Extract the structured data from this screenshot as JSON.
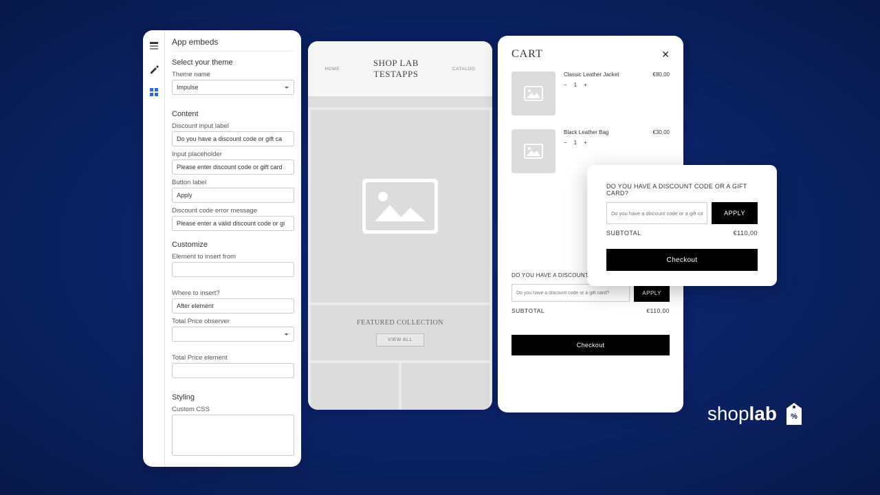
{
  "admin": {
    "title": "App embeds",
    "select_theme_heading": "Select your theme",
    "theme_name_label": "Theme name",
    "theme_value": "Impulse",
    "content_heading": "Content",
    "fields": {
      "discount_input_label": {
        "label": "Discount input label",
        "value": "Do you have a discount code or gift ca"
      },
      "input_placeholder": {
        "label": "Input placeholder",
        "value": "Please enter discount code or gift card"
      },
      "button_label": {
        "label": "Button label",
        "value": "Apply"
      },
      "discount_error": {
        "label": "Discount code error message",
        "value": "Please enter a valid discount code or gi"
      }
    },
    "customize_heading": "Customize",
    "element_to_insert_label": "Element to insert from",
    "where_to_insert_label": "Where to insert?",
    "where_to_insert_value": "After element",
    "total_price_observer_label": "Total Price observer",
    "total_price_element_label": "Total Price element",
    "styling_heading": "Styling",
    "custom_css_label": "Custom CSS"
  },
  "preview": {
    "home": "HOME",
    "catalog": "CATALOG",
    "logo_line1": "SHOP LAB",
    "logo_line2": "TESTAPPS",
    "featured": "FEATURED COLLECTION",
    "view_all": "VIEW ALL"
  },
  "cart": {
    "title": "CART",
    "items": [
      {
        "name": "Classic Leather Jacket",
        "qty": "1",
        "price": "€80,00"
      },
      {
        "name": "Black Leather Bag",
        "qty": "1",
        "price": "€30,00"
      }
    ],
    "discount_label": "DO YOU HAVE A DISCOUNT CODE OR A GIFT CARD?",
    "discount_placeholder": "Do you have a discount code or a gift card?",
    "apply": "APPLY",
    "subtotal_label": "SUBTOTAL",
    "subtotal_value": "€110,00",
    "checkout": "Checkout"
  },
  "popover": {
    "discount_label": "DO YOU HAVE A DISCOUNT CODE OR A GIFT CARD?",
    "discount_placeholder": "Do you have a discount code or a gift card?",
    "apply": "APPLY",
    "subtotal_label": "SUBTOTAL",
    "subtotal_value": "€110,00",
    "checkout": "Checkout"
  },
  "brand": "shoplab"
}
